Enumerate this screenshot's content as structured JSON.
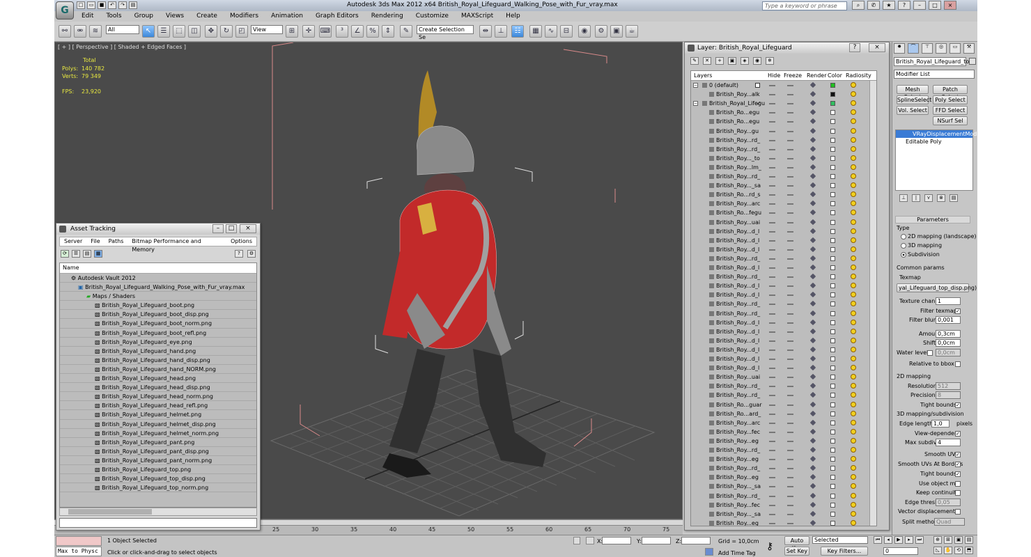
{
  "app": {
    "title": "Autodesk 3ds Max  2012 x64      British_Royal_Lifeguard_Walking_Pose_with_Fur_vray.max",
    "search_placeholder": "Type a keyword or phrase",
    "menus": [
      "Edit",
      "Tools",
      "Group",
      "Views",
      "Create",
      "Modifiers",
      "Animation",
      "Graph Editors",
      "Rendering",
      "Customize",
      "MAXScript",
      "Help"
    ]
  },
  "toolbar": {
    "selection_filter": "All",
    "ref_coord": "View",
    "named_selection": "Create Selection Se"
  },
  "viewport": {
    "label": "[ + ] [ Perspective ] [ Shaded + Edged Faces ]",
    "stats": {
      "total_label": "Total",
      "polys_label": "Polys:",
      "polys": "140 782",
      "verts_label": "Verts:",
      "verts": "79 349",
      "fps_label": "FPS:",
      "fps": "23,920"
    }
  },
  "timeline": {
    "ticks": [
      "25",
      "30",
      "35",
      "40",
      "45",
      "50",
      "55",
      "60",
      "65",
      "70",
      "75"
    ]
  },
  "status": {
    "maxscript": "Max to Physc",
    "selected": "1 Object Selected",
    "prompt": "Click or click-and-drag to select objects",
    "x_label": "X:",
    "y_label": "Y:",
    "z_label": "Z:",
    "grid": "Grid = 10,0cm",
    "add_time_tag": "Add Time Tag",
    "auto_key": "Auto Key",
    "set_key": "Set Key",
    "key_mode": "Selected",
    "key_filters": "Key Filters...",
    "frame": "0"
  },
  "asset_tracking": {
    "title": "Asset Tracking",
    "menus": [
      "Server",
      "File",
      "Paths",
      "Bitmap Performance and Memory",
      "Options"
    ],
    "column": "Name",
    "vault": "Autodesk Vault 2012",
    "file": "British_Royal_Lifeguard_Walking_Pose_with_Fur_vray.max",
    "maps_folder": "Maps / Shaders",
    "maps": [
      "British_Royal_Lifeguard_boot.png",
      "British_Royal_Lifeguard_boot_disp.png",
      "British_Royal_Lifeguard_boot_norm.png",
      "British_Royal_Lifeguard_boot_refl.png",
      "British_Royal_Lifeguard_eye.png",
      "British_Royal_Lifeguard_hand.png",
      "British_Royal_Lifeguard_hand_disp.png",
      "British_Royal_Lifeguard_hand_NORM.png",
      "British_Royal_Lifeguard_head.png",
      "British_Royal_Lifeguard_head_disp.png",
      "British_Royal_Lifeguard_head_norm.png",
      "British_Royal_Lifeguard_head_refl.png",
      "British_Royal_Lifeguard_helmet.png",
      "British_Royal_Lifeguard_helmet_disp.png",
      "British_Royal_Lifeguard_helmet_norm.png",
      "British_Royal_Lifeguard_pant.png",
      "British_Royal_Lifeguard_pant_disp.png",
      "British_Royal_Lifeguard_pant_norm.png",
      "British_Royal_Lifeguard_top.png",
      "British_Royal_Lifeguard_top_disp.png",
      "British_Royal_Lifeguard_top_norm.png"
    ]
  },
  "layer_manager": {
    "title": "Layer: British_Royal_Lifeguard",
    "columns": [
      "Layers",
      "Hide",
      "Freeze",
      "Render",
      "Color",
      "Radiosity"
    ],
    "layers": [
      {
        "name": "0 (default)",
        "indent": 0,
        "color": "#20c020",
        "current": false
      },
      {
        "name": "British_Roy...alk",
        "indent": 1,
        "color": "#101010",
        "current": false
      },
      {
        "name": "British_Royal_Lifegu",
        "indent": 0,
        "color": "#30c060",
        "current": true
      },
      {
        "name": "British_Ro...egu",
        "indent": 1,
        "color": "",
        "current": false
      },
      {
        "name": "British_Ro...egu",
        "indent": 1,
        "color": "",
        "current": false
      },
      {
        "name": "British_Roy...gu",
        "indent": 1,
        "color": "",
        "current": false
      },
      {
        "name": "British_Roy...rd_",
        "indent": 1,
        "color": "",
        "current": false
      },
      {
        "name": "British_Roy...rd_",
        "indent": 1,
        "color": "",
        "current": false
      },
      {
        "name": "British_Roy..._to",
        "indent": 1,
        "color": "",
        "current": false
      },
      {
        "name": "British_Roy...lm_",
        "indent": 1,
        "color": "",
        "current": false
      },
      {
        "name": "British_Roy...rd_",
        "indent": 1,
        "color": "",
        "current": false
      },
      {
        "name": "British_Roy..._sa",
        "indent": 1,
        "color": "",
        "current": false
      },
      {
        "name": "British_Ro...rd_s",
        "indent": 1,
        "color": "",
        "current": false
      },
      {
        "name": "British_Roy...arc",
        "indent": 1,
        "color": "",
        "current": false
      },
      {
        "name": "British_Ro...fegu",
        "indent": 1,
        "color": "",
        "current": false
      },
      {
        "name": "British_Roy...uai",
        "indent": 1,
        "color": "",
        "current": false
      },
      {
        "name": "British_Roy...d_l",
        "indent": 1,
        "color": "",
        "current": false
      },
      {
        "name": "British_Roy...d_l",
        "indent": 1,
        "color": "",
        "current": false
      },
      {
        "name": "British_Roy...d_l",
        "indent": 1,
        "color": "",
        "current": false
      },
      {
        "name": "British_Roy...rd_",
        "indent": 1,
        "color": "",
        "current": false
      },
      {
        "name": "British_Roy...d_l",
        "indent": 1,
        "color": "",
        "current": false
      },
      {
        "name": "British_Roy...rd_",
        "indent": 1,
        "color": "",
        "current": false
      },
      {
        "name": "British_Roy...d_l",
        "indent": 1,
        "color": "",
        "current": false
      },
      {
        "name": "British_Roy...d_l",
        "indent": 1,
        "color": "",
        "current": false
      },
      {
        "name": "British_Roy...rd_",
        "indent": 1,
        "color": "",
        "current": false
      },
      {
        "name": "British_Roy...rd_",
        "indent": 1,
        "color": "",
        "current": false
      },
      {
        "name": "British_Roy...d_l",
        "indent": 1,
        "color": "",
        "current": false
      },
      {
        "name": "British_Roy...d_l",
        "indent": 1,
        "color": "",
        "current": false
      },
      {
        "name": "British_Roy...d_l",
        "indent": 1,
        "color": "",
        "current": false
      },
      {
        "name": "British_Roy...d_l",
        "indent": 1,
        "color": "",
        "current": false
      },
      {
        "name": "British_Roy...d_l",
        "indent": 1,
        "color": "",
        "current": false
      },
      {
        "name": "British_Roy...d_l",
        "indent": 1,
        "color": "",
        "current": false
      },
      {
        "name": "British_Roy...uai",
        "indent": 1,
        "color": "",
        "current": false
      },
      {
        "name": "British_Roy...rd_",
        "indent": 1,
        "color": "",
        "current": false
      },
      {
        "name": "British_Roy...rd_",
        "indent": 1,
        "color": "",
        "current": false
      },
      {
        "name": "British_Ro...guar",
        "indent": 1,
        "color": "",
        "current": false
      },
      {
        "name": "British_Ro...ard_",
        "indent": 1,
        "color": "",
        "current": false
      },
      {
        "name": "British_Roy...arc",
        "indent": 1,
        "color": "",
        "current": false
      },
      {
        "name": "British_Roy...fec",
        "indent": 1,
        "color": "",
        "current": false
      },
      {
        "name": "British_Roy...eg",
        "indent": 1,
        "color": "",
        "current": false
      },
      {
        "name": "British_Roy...rd_",
        "indent": 1,
        "color": "",
        "current": false
      },
      {
        "name": "British_Roy...eg",
        "indent": 1,
        "color": "",
        "current": false
      },
      {
        "name": "British_Roy...rd_",
        "indent": 1,
        "color": "",
        "current": false
      },
      {
        "name": "British_Roy...eg",
        "indent": 1,
        "color": "",
        "current": false
      },
      {
        "name": "British_Roy..._sa",
        "indent": 1,
        "color": "",
        "current": false
      },
      {
        "name": "British_Roy...rd_",
        "indent": 1,
        "color": "",
        "current": false
      },
      {
        "name": "British_Roy...fec",
        "indent": 1,
        "color": "",
        "current": false
      },
      {
        "name": "British_Roy..._sa",
        "indent": 1,
        "color": "",
        "current": false
      },
      {
        "name": "British_Roy...eg",
        "indent": 1,
        "color": "",
        "current": false
      }
    ]
  },
  "command_panel": {
    "object_name": "British_Royal_Lifeguard_top",
    "modifier_list": "Modifier List",
    "buttons": [
      "Mesh Select",
      "Patch Select",
      "SplineSelect",
      "Poly Select",
      "Vol. Select",
      "FFD Select",
      "NSurf Sel"
    ],
    "stack": [
      "VRayDisplacementMod",
      "Editable Poly"
    ],
    "rollout": "Parameters",
    "type_label": "Type",
    "type_options": [
      "2D mapping (landscape)",
      "3D mapping",
      "Subdivision"
    ],
    "common_params": "Common params",
    "texmap_label": "Texmap",
    "texmap_value": "yal_Lifeguard_top_disp.png)",
    "texture_chan_label": "Texture chan",
    "texture_chan": "1",
    "filter_texmap": "Filter texmap",
    "filter_blur_label": "Filter blur",
    "filter_blur": "0,001",
    "amount_label": "Amount",
    "amount": "0,3cm",
    "shift_label": "Shift",
    "shift": "0,0cm",
    "water_level_label": "Water level",
    "water_level": "0,0cm",
    "relative_bbox": "Relative to bbox",
    "mapping_2d": "2D mapping",
    "resolution_label": "Resolution",
    "resolution": "512",
    "precision_label": "Precision",
    "precision": "8",
    "tight_bounds_2d": "Tight bounds",
    "mapping_3d": "3D mapping/subdivision",
    "edge_length_label": "Edge length",
    "edge_length": "1,0",
    "pixels": "pixels",
    "view_dependent": "View-dependent",
    "max_subdivs_label": "Max subdivs",
    "max_subdivs": "4",
    "smooth_uvs": "Smooth UVs",
    "smooth_uvs_borders": "Smooth UVs At Borders",
    "tight_bounds_3d": "Tight bounds",
    "use_object_mtl": "Use object mtl",
    "keep_continuity": "Keep continuity",
    "edge_thresh_label": "Edge thresh",
    "edge_thresh": "0,05",
    "vector_displacement": "Vector displacement",
    "split_method_label": "Split method",
    "split_method": "Quad"
  }
}
